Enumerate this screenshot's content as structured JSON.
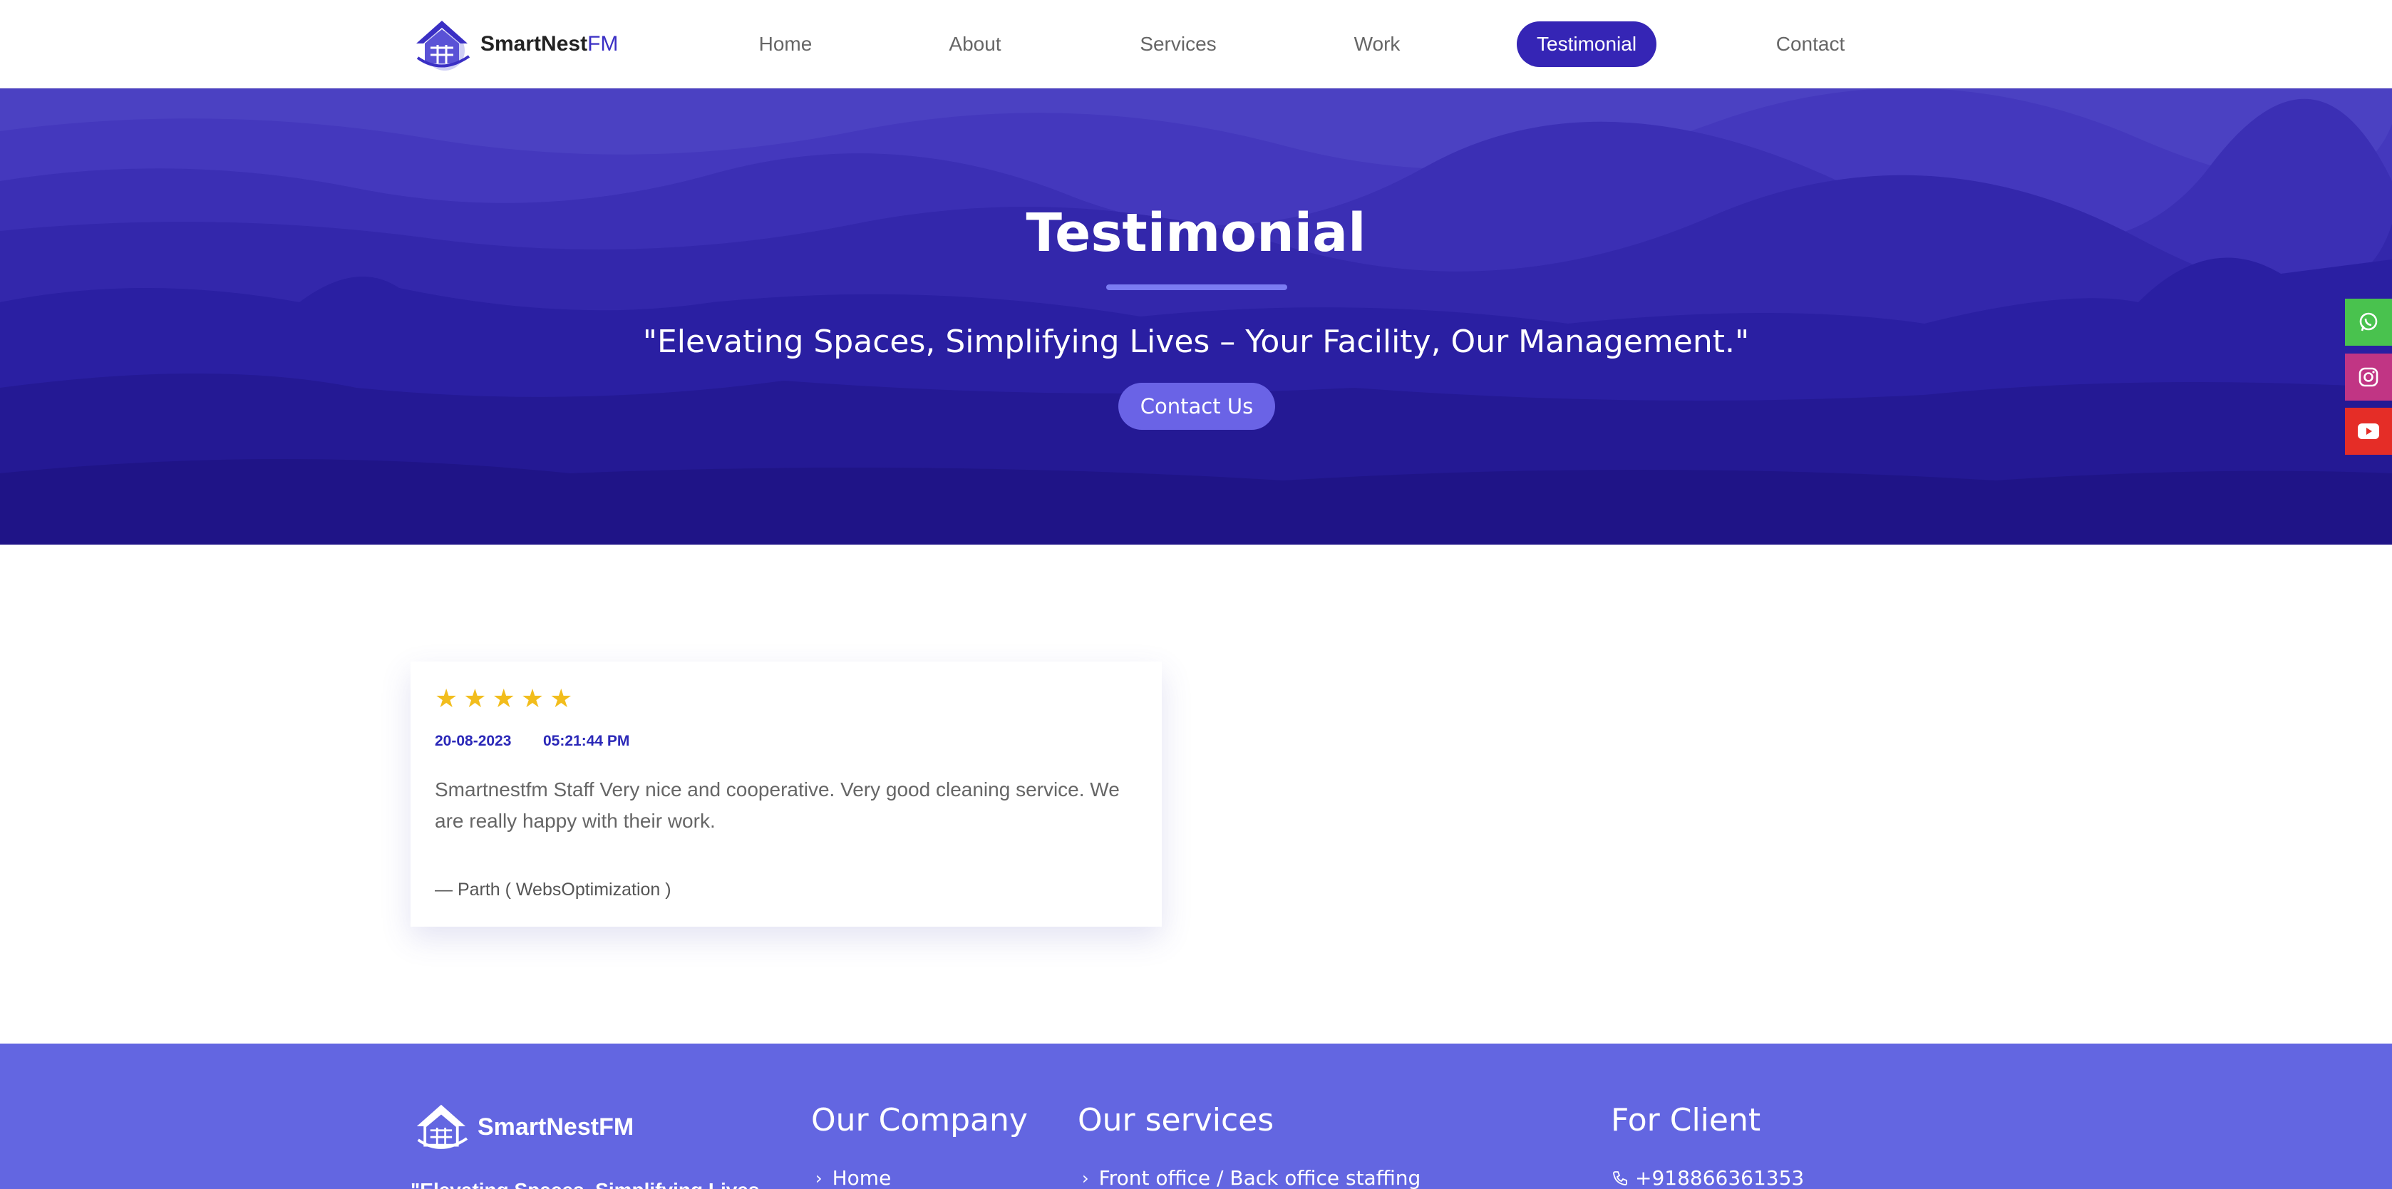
{
  "nav": {
    "brand_main": "SmartNest",
    "brand_accent": "FM",
    "items": [
      {
        "label": "Home"
      },
      {
        "label": "About"
      },
      {
        "label": "Services"
      },
      {
        "label": "Work"
      },
      {
        "label": "Testimonial"
      },
      {
        "label": "Contact"
      }
    ],
    "active": "Testimonial"
  },
  "hero": {
    "title": "Testimonial",
    "subtitle": "\"Elevating Spaces, Simplifying Lives – Your Facility, Our Management.\"",
    "button_label": "Contact Us"
  },
  "social": {
    "icons": [
      "whatsapp-icon",
      "instagram-icon",
      "youtube-icon"
    ],
    "colors": {
      "whatsapp": "#49c24e",
      "instagram": "#c13584",
      "youtube": "#e52d27"
    }
  },
  "testimonial": {
    "rating": 5,
    "rating_max": 5,
    "date": "20-08-2023",
    "time": "05:21:44 PM",
    "text": "Smartnestfm Staff Very nice and cooperative. Very good cleaning service. We are really happy with their work.",
    "author": "— Parth ( WebsOptimization )"
  },
  "footer": {
    "brand": "SmartNestFM",
    "tagline": "\"Elevating Spaces, Simplifying Lives",
    "company_heading": "Our Company",
    "company_first_link": "Home",
    "services_heading": "Our services",
    "services_first_link": "Front office / Back office staffing",
    "client_heading": "For Client",
    "client_phone": "+918866361353"
  },
  "colors": {
    "primary": "#3525b5",
    "hero_bg": "#3d2fb8",
    "footer_bg": "#6366e1",
    "star": "#f2bd1c",
    "date_text": "#2b28b8"
  }
}
